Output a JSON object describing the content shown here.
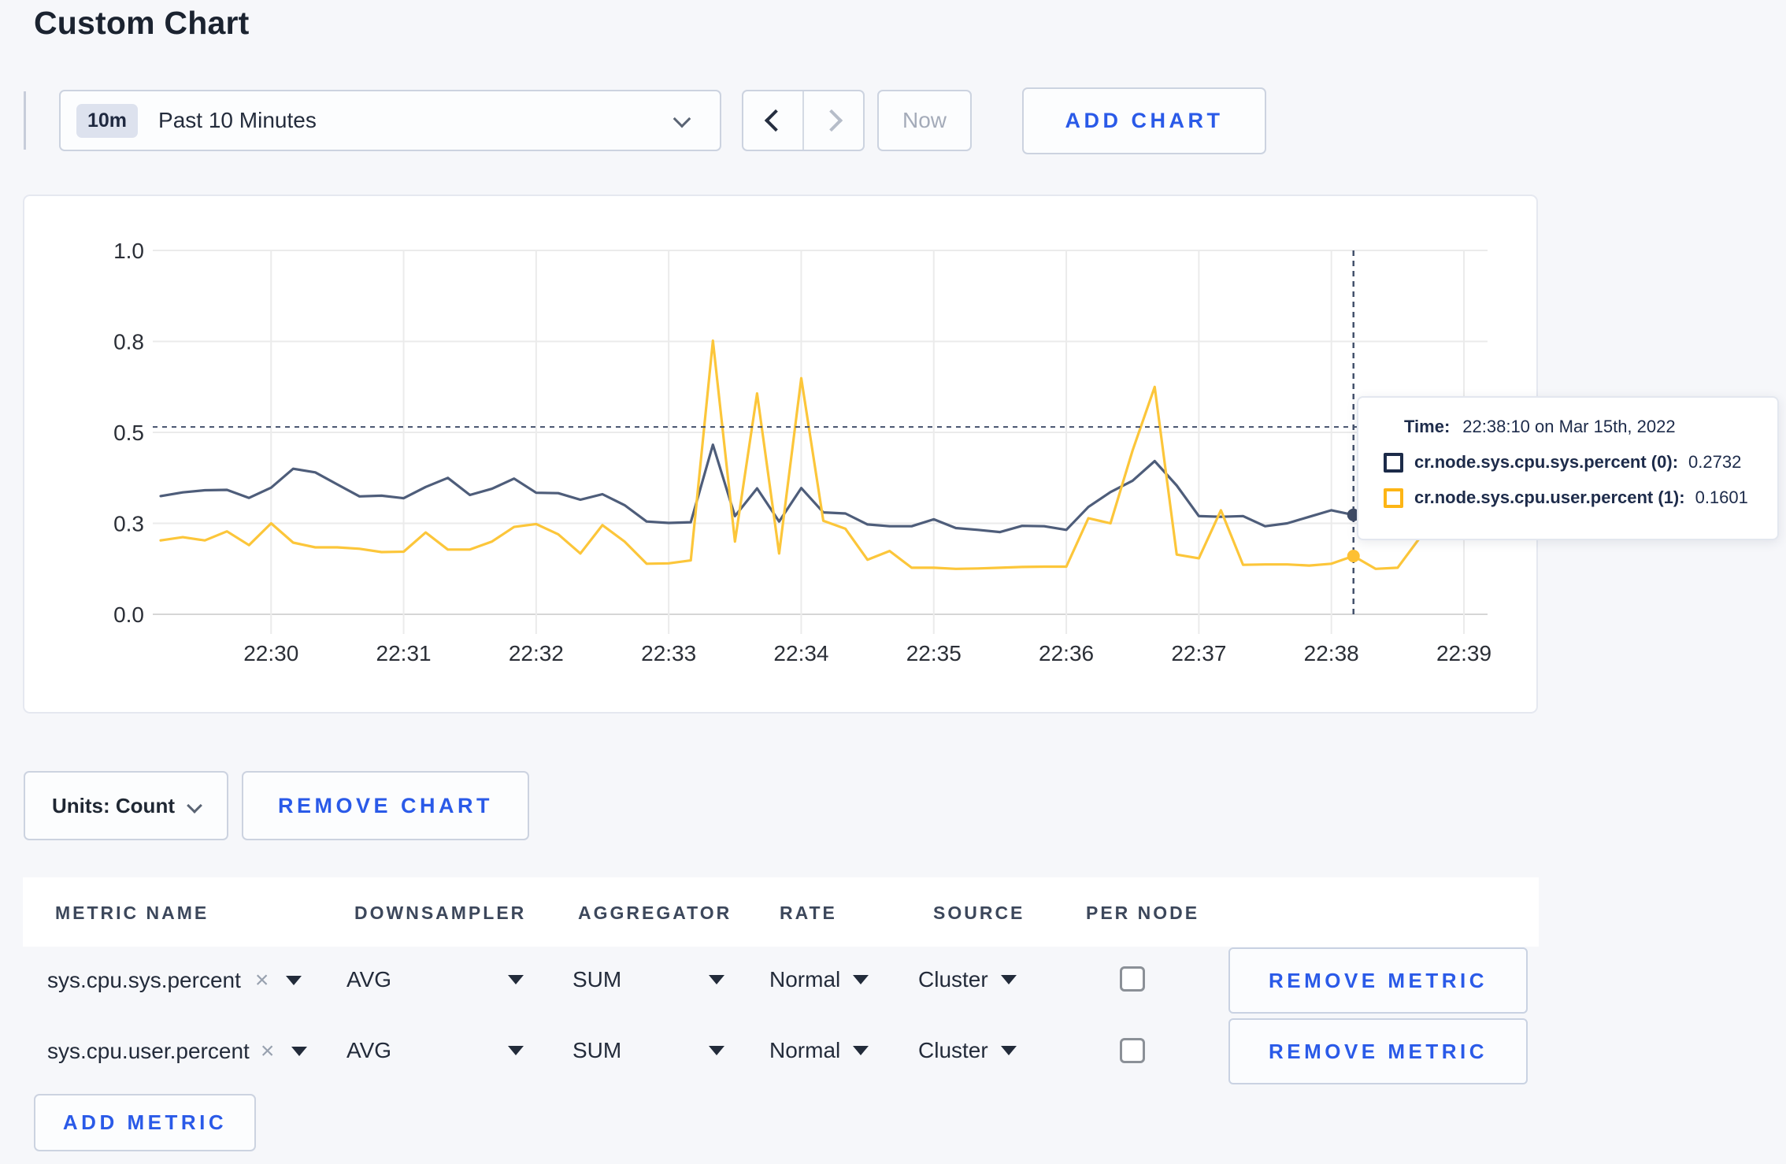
{
  "page": {
    "title": "Custom Chart"
  },
  "colors": {
    "accent_blue": "#2a5ae8",
    "series_sys": "#4e5d7a",
    "series_user": "#fcc63a",
    "swatch_sys": "#1c2b49",
    "swatch_user": "#fdb515",
    "grid": "#ebebeb",
    "axis_zero": "#d6d6d6",
    "crosshair": "#44516c"
  },
  "toolbar": {
    "time_range": {
      "badge": "10m",
      "label": "Past 10 Minutes"
    },
    "now_label": "Now",
    "add_chart_label": "ADD CHART"
  },
  "chart_data": {
    "type": "line",
    "title": "",
    "xlabel": "",
    "ylabel": "",
    "ylim": [
      0,
      1
    ],
    "grid": true,
    "x_unit": "seconds since 22:29:10",
    "x_step_s": 10,
    "x_domain_s": [
      0,
      590
    ],
    "y_ticks": [
      {
        "v": 0.0,
        "label": "0.0"
      },
      {
        "v": 0.25,
        "label": "0.3"
      },
      {
        "v": 0.5,
        "label": "0.5"
      },
      {
        "v": 0.75,
        "label": "0.8"
      },
      {
        "v": 1.0,
        "label": "1.0"
      }
    ],
    "x_ticks": [
      {
        "s": 50,
        "label": "22:30"
      },
      {
        "s": 110,
        "label": "22:31"
      },
      {
        "s": 170,
        "label": "22:32"
      },
      {
        "s": 230,
        "label": "22:33"
      },
      {
        "s": 290,
        "label": "22:34"
      },
      {
        "s": 350,
        "label": "22:35"
      },
      {
        "s": 410,
        "label": "22:36"
      },
      {
        "s": 470,
        "label": "22:37"
      },
      {
        "s": 530,
        "label": "22:38"
      },
      {
        "s": 590,
        "label": "22:39"
      }
    ],
    "series": [
      {
        "name": "cr.node.sys.cpu.sys.percent",
        "values": [
          0.325,
          0.335,
          0.341,
          0.342,
          0.32,
          0.348,
          0.4,
          0.39,
          0.357,
          0.324,
          0.326,
          0.319,
          0.35,
          0.375,
          0.328,
          0.345,
          0.373,
          0.334,
          0.333,
          0.315,
          0.33,
          0.3,
          0.255,
          0.251,
          0.253,
          0.466,
          0.27,
          0.346,
          0.255,
          0.347,
          0.28,
          0.277,
          0.247,
          0.242,
          0.242,
          0.261,
          0.237,
          0.232,
          0.226,
          0.243,
          0.242,
          0.232,
          0.295,
          0.336,
          0.367,
          0.421,
          0.354,
          0.27,
          0.268,
          0.27,
          0.242,
          0.25,
          0.268,
          0.286,
          0.2732,
          0.25,
          0.255,
          0.265,
          0.285,
          0.3
        ]
      },
      {
        "name": "cr.node.sys.cpu.user.percent",
        "values": [
          0.203,
          0.212,
          0.203,
          0.228,
          0.19,
          0.25,
          0.197,
          0.184,
          0.184,
          0.18,
          0.171,
          0.172,
          0.225,
          0.178,
          0.178,
          0.2,
          0.24,
          0.248,
          0.22,
          0.167,
          0.245,
          0.2,
          0.139,
          0.14,
          0.148,
          0.752,
          0.2,
          0.607,
          0.167,
          0.649,
          0.257,
          0.235,
          0.15,
          0.174,
          0.128,
          0.128,
          0.125,
          0.126,
          0.128,
          0.13,
          0.131,
          0.131,
          0.264,
          0.25,
          0.45,
          0.625,
          0.164,
          0.154,
          0.286,
          0.136,
          0.137,
          0.137,
          0.134,
          0.139,
          0.1601,
          0.125,
          0.128,
          0.21,
          0.295,
          0.23
        ]
      }
    ],
    "crosshair": {
      "s": 540,
      "hline_value": 0.515,
      "points": [
        0.2732,
        0.1601
      ]
    }
  },
  "tooltip": {
    "time_label": "Time:",
    "time_value": "22:38:10 on Mar 15th, 2022",
    "series": [
      {
        "label": "cr.node.sys.cpu.sys.percent (0):",
        "value": "0.2732"
      },
      {
        "label": "cr.node.sys.cpu.user.percent (1):",
        "value": "0.1601"
      }
    ]
  },
  "chart_footer": {
    "units_label": "Units: Count",
    "remove_chart_label": "REMOVE CHART"
  },
  "icons": {
    "clear": "×"
  },
  "table": {
    "headers": [
      "METRIC NAME",
      "DOWNSAMPLER",
      "AGGREGATOR",
      "RATE",
      "SOURCE",
      "PER NODE"
    ],
    "rows": [
      {
        "metric_name": "sys.cpu.sys.percent",
        "downsampler": "AVG",
        "aggregator": "SUM",
        "rate": "Normal",
        "source": "Cluster",
        "per_node_checked": false
      },
      {
        "metric_name": "sys.cpu.user.percent",
        "downsampler": "AVG",
        "aggregator": "SUM",
        "rate": "Normal",
        "source": "Cluster",
        "per_node_checked": false
      }
    ],
    "remove_metric_label": "REMOVE METRIC",
    "add_metric_label": "ADD METRIC"
  }
}
